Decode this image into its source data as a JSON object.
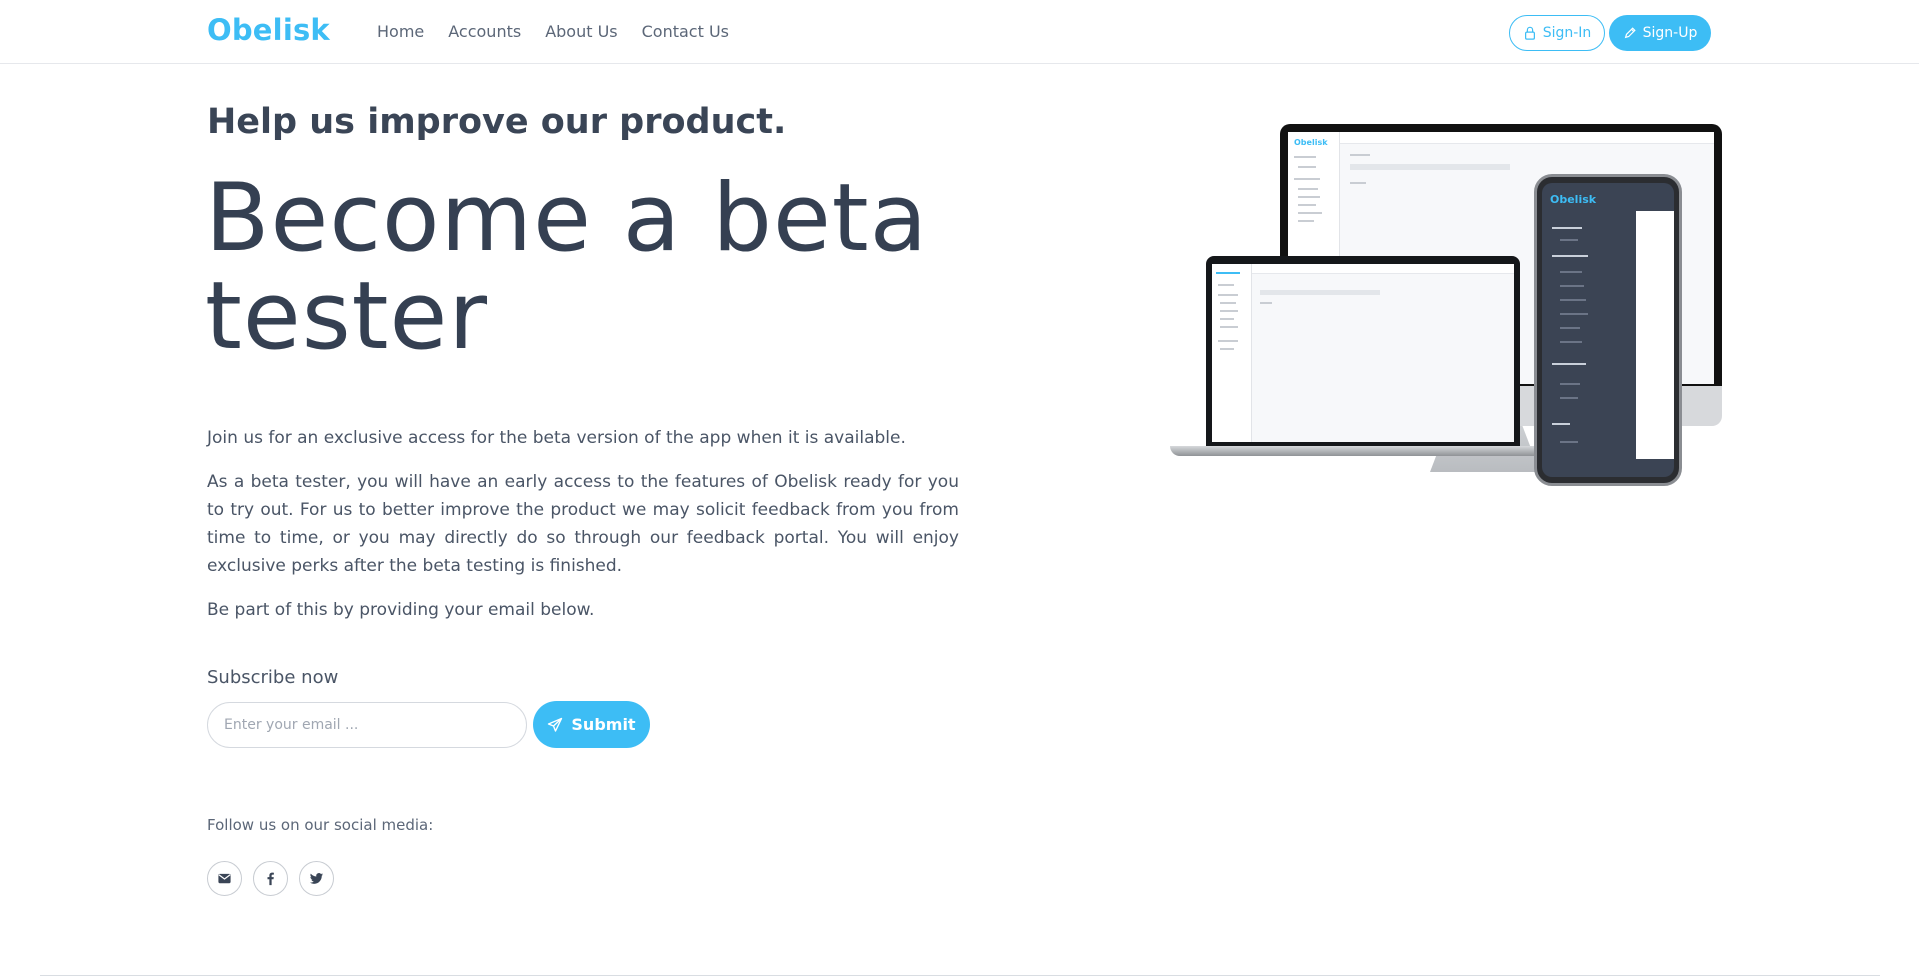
{
  "nav": {
    "brand": "Obelisk",
    "links": [
      "Home",
      "Accounts",
      "About Us",
      "Contact Us"
    ],
    "signin_label": "Sign-In",
    "signup_label": "Sign-Up"
  },
  "hero": {
    "eyebrow": "Help us improve our product.",
    "headline": "Become a beta tester",
    "paragraphs": [
      "Join us for an exclusive access for the beta version of the app when it is available.",
      "As a beta tester, you will have an early access to the features of Obelisk ready for you to try out. For us to better improve the product we may solicit feedback from you from time to time, or you may directly do so through our feedback portal. You will enjoy exclusive perks after the beta testing is finished.",
      "Be part of this by providing your email below."
    ]
  },
  "subscribe": {
    "label": "Subscribe now",
    "placeholder": "Enter your email ...",
    "submit_label": "Submit"
  },
  "social": {
    "label": "Follow us on our social media:",
    "icons": [
      "envelope-icon",
      "facebook-icon",
      "twitter-icon"
    ]
  },
  "illustration": {
    "mini_brand": "Obelisk"
  },
  "colors": {
    "accent": "#3dbdf5",
    "text": "#3a4556",
    "phone_sidebar": "#3b4454"
  }
}
